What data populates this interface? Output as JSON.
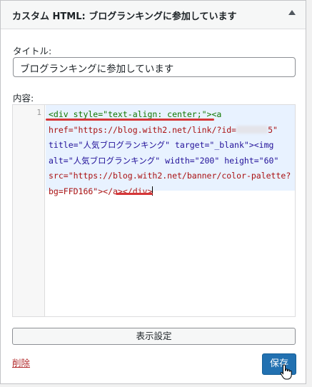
{
  "widget": {
    "title": "カスタム HTML: ブログランキングに参加しています",
    "toggle_icon": "arrow-up-icon"
  },
  "form": {
    "title_label": "タイトル:",
    "title_value": "ブログランキングに参加しています",
    "content_label": "内容:"
  },
  "editor": {
    "line_number": "1",
    "lines": [
      "<div style=\"text-align: center;\"><a",
      "href=\"https://blog.with2.net/link/?id=",
      "5\"",
      "title=\"人気ブログランキング\" target=\"_blank\"><img",
      "alt=\"人気ブログランキング\" width=\"200\" height=\"60\"",
      "src=\"https://blog.with2.net/banner/color-palette?",
      "bg=FFD166\"></a></div>"
    ]
  },
  "actions": {
    "display_settings": "表示設定",
    "delete": "削除",
    "save": "保存"
  },
  "colors": {
    "accent": "#2271b1",
    "annotation": "#d63638",
    "delete": "#b32d2e"
  }
}
